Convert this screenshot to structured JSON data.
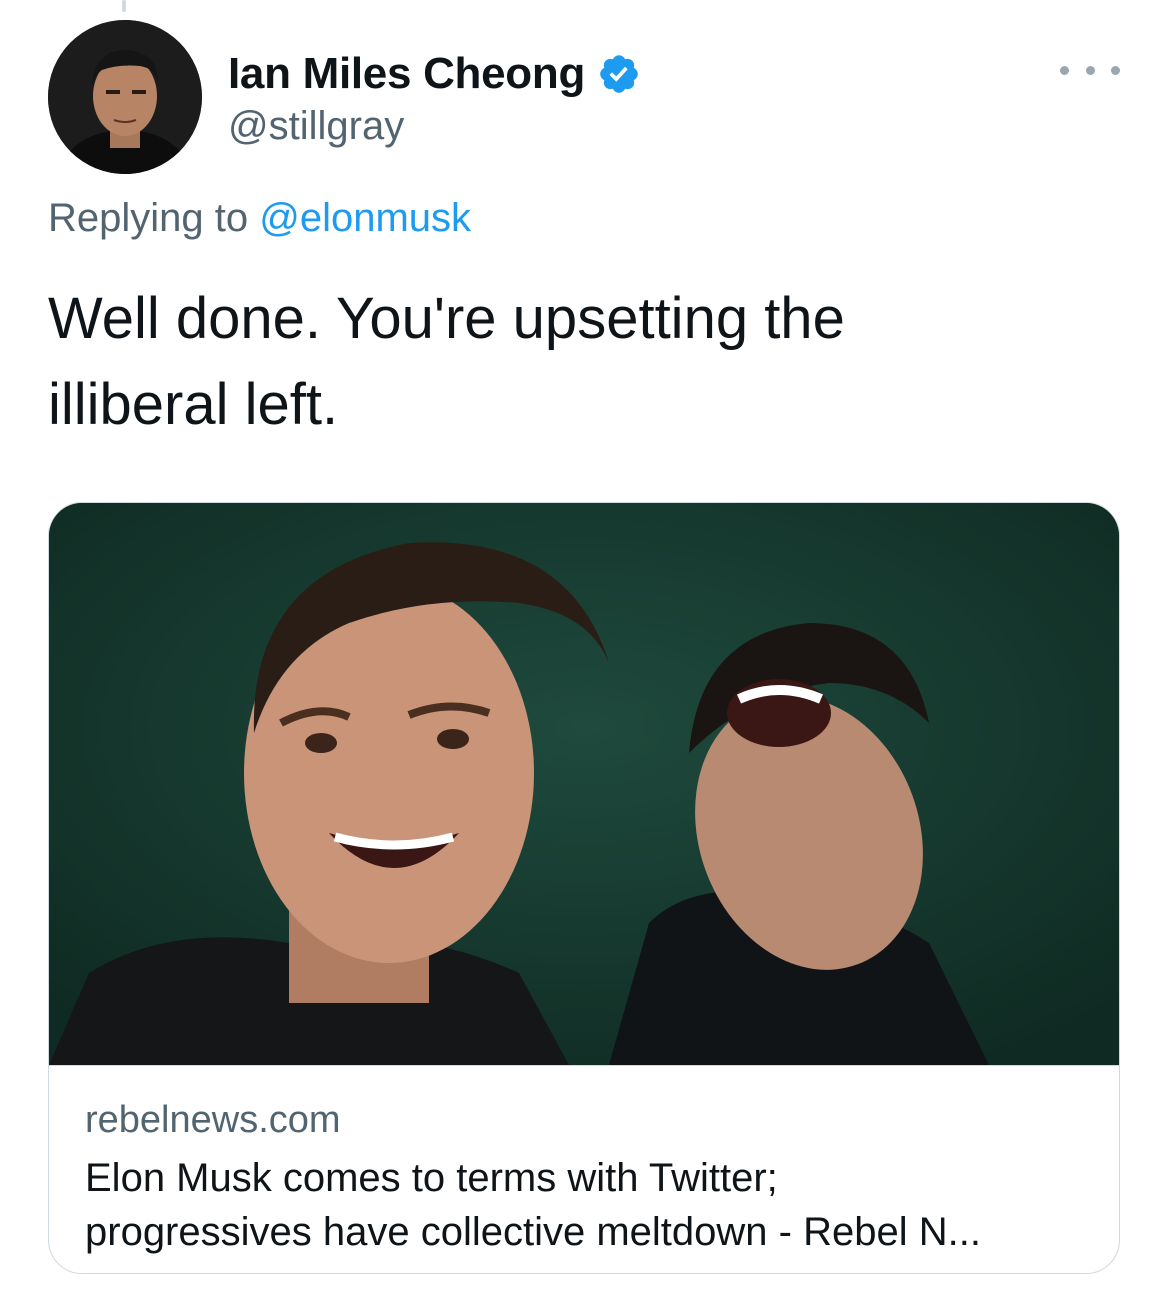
{
  "author": {
    "display_name": "Ian Miles Cheong",
    "handle": "@stillgray",
    "verified": true,
    "avatar_icon": "profile-photo"
  },
  "reply": {
    "prefix": "Replying to ",
    "mention": "@elonmusk"
  },
  "tweet": {
    "text": "Well done. You're upsetting the\nilliberal left."
  },
  "card": {
    "image_icon": "link-preview-photo",
    "domain": "rebelnews.com",
    "title": "Elon Musk comes to terms with Twitter;\nprogressives have collective meltdown - Rebel N..."
  },
  "colors": {
    "text_primary": "#0f1419",
    "text_secondary": "#536471",
    "link": "#1d9bf0",
    "verified": "#1d9bf0",
    "border": "#cfd9de",
    "card_image_bg": "#173a30"
  }
}
